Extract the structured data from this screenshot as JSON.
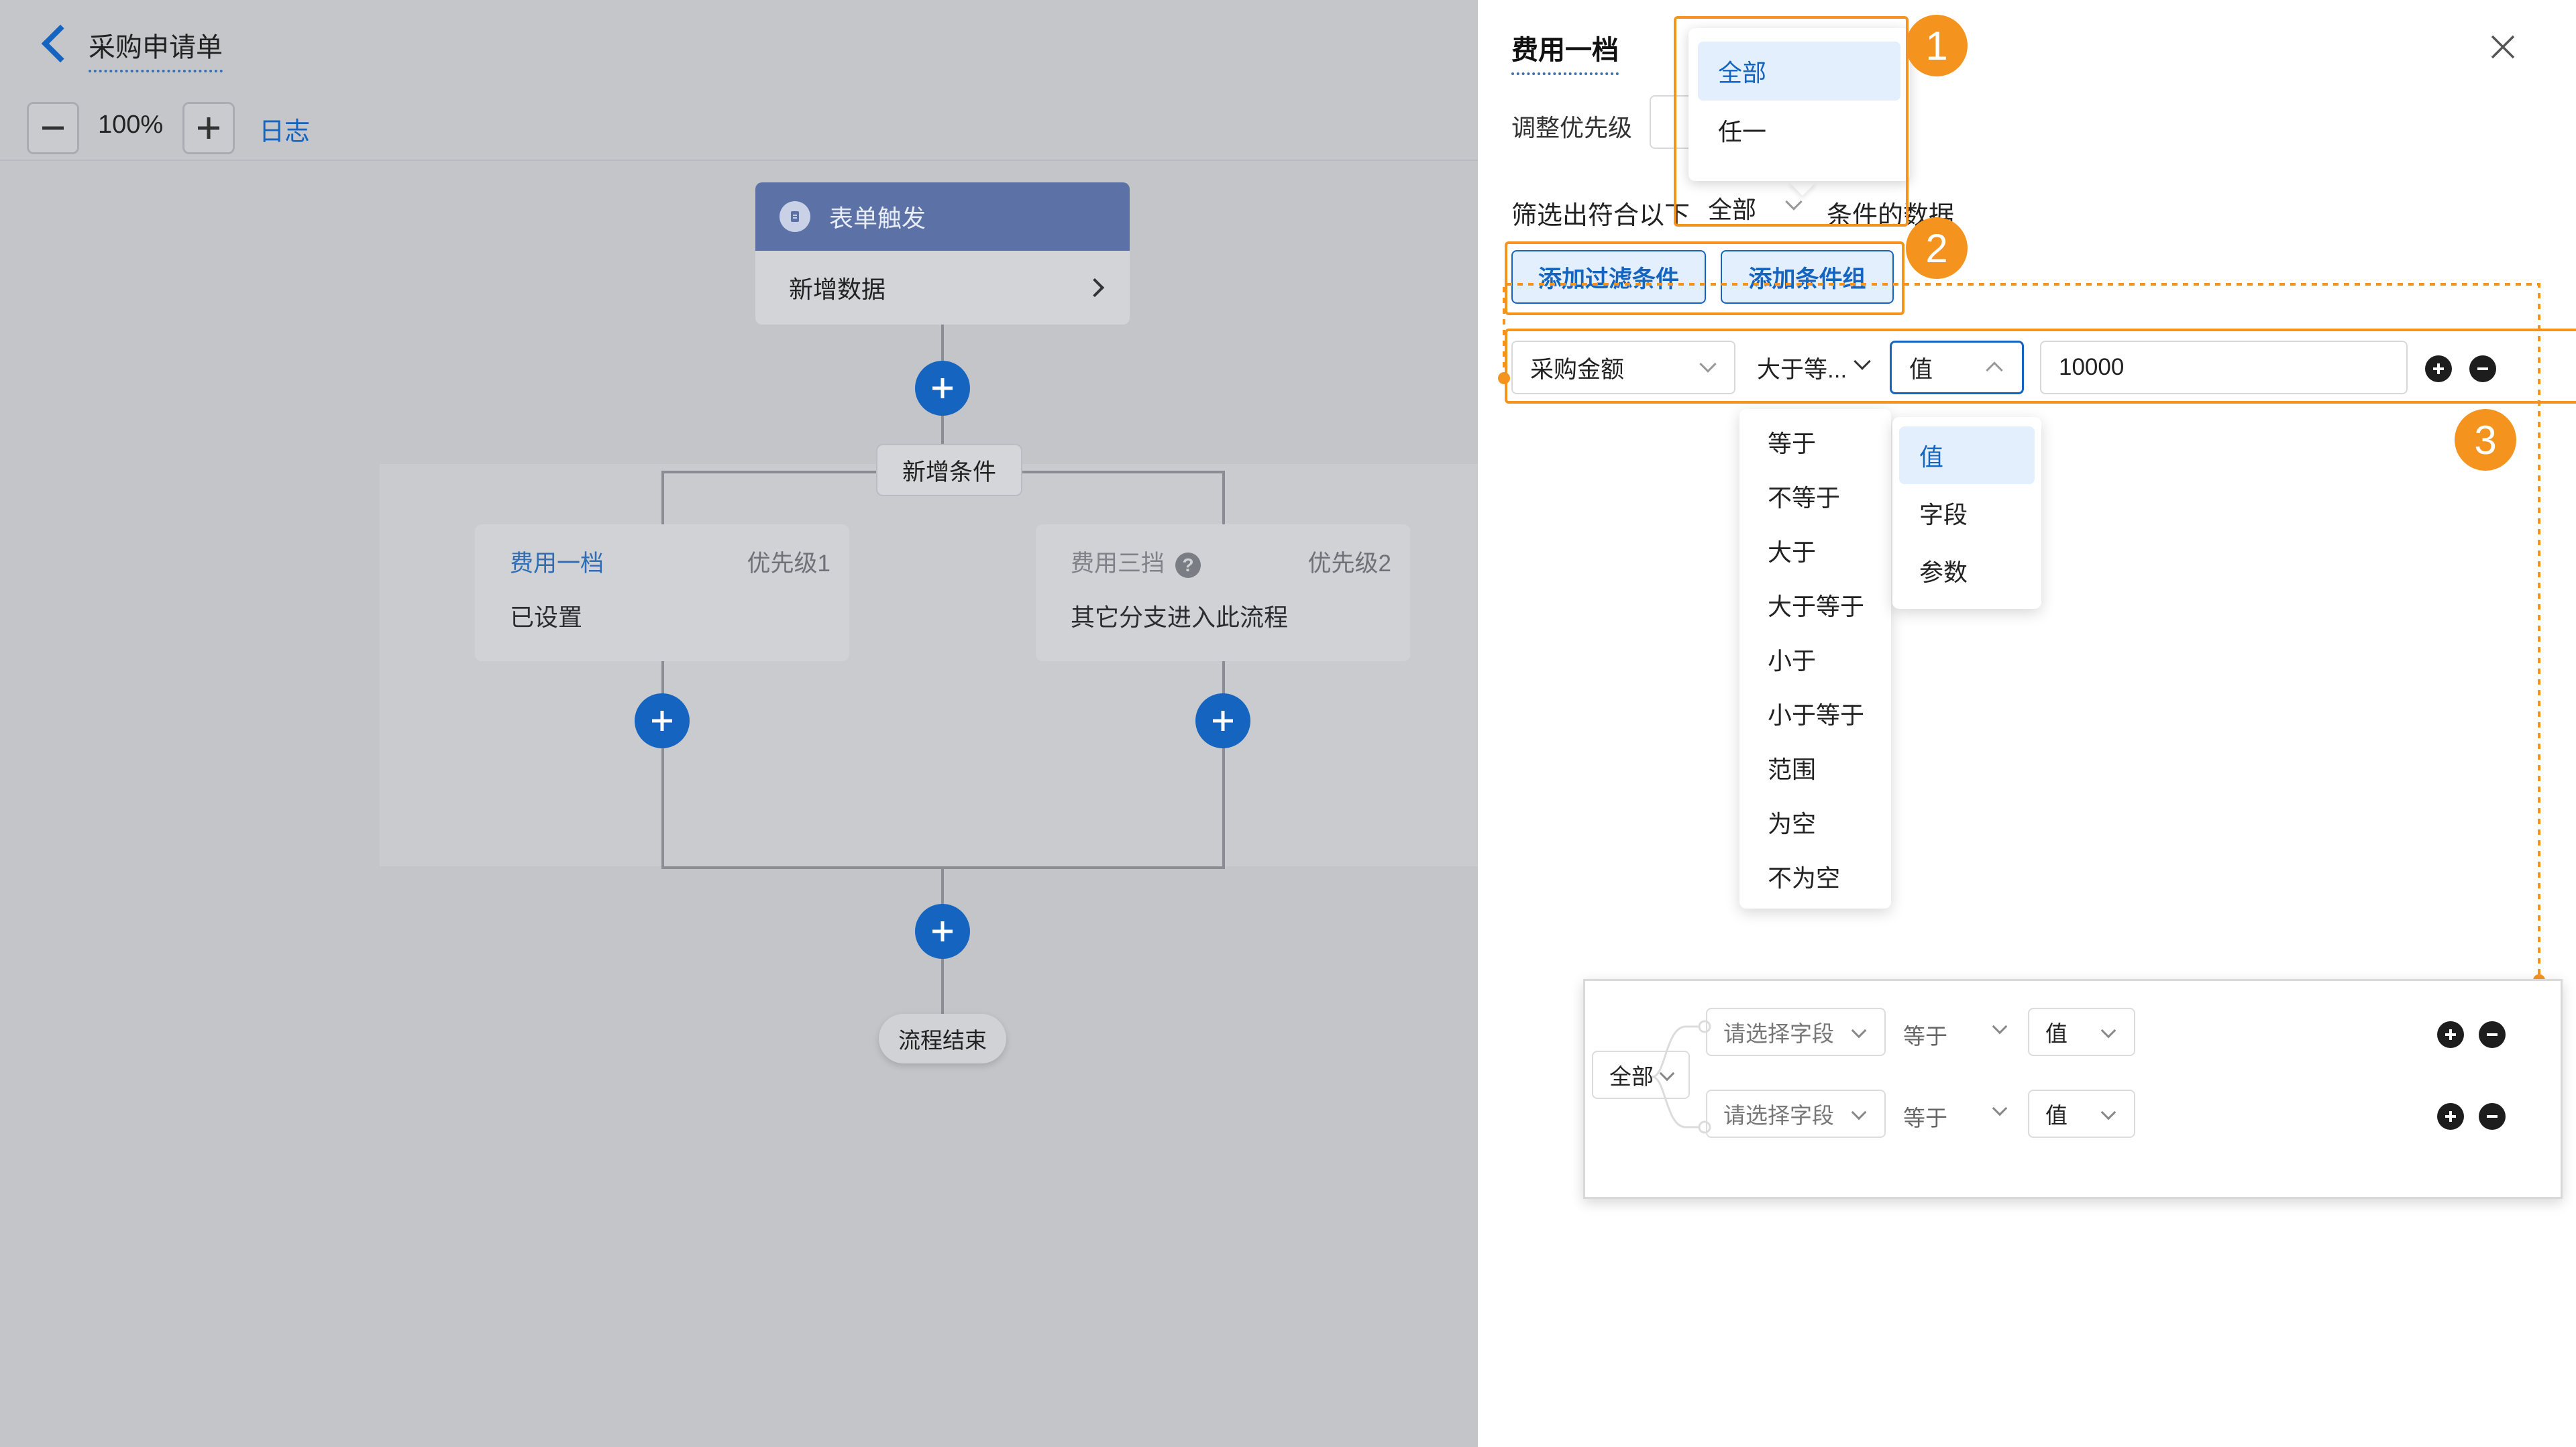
{
  "header": {
    "title": "采购申请单",
    "zoom": "100%",
    "log_label": "日志"
  },
  "flow": {
    "trigger": {
      "title": "表单触发",
      "body": "新增数据"
    },
    "add_condition_label": "新增条件",
    "branches": [
      {
        "title": "费用一档",
        "priority": "优先级1",
        "desc": "已设置"
      },
      {
        "title": "费用三挡",
        "priority": "优先级2",
        "desc": "其它分支进入此流程"
      }
    ],
    "end_label": "流程结束"
  },
  "panel": {
    "title": "费用一档",
    "priority_label": "调整优先级",
    "filter_prefix": "筛选出符合以下",
    "filter_match": "全部",
    "filter_suffix": "条件的数据",
    "add_filter_label": "添加过滤条件",
    "add_group_label": "添加条件组",
    "condition": {
      "field": "采购金额",
      "operator": "大于等...",
      "value_type": "值",
      "value": "10000"
    },
    "match_options": [
      "全部",
      "任一"
    ],
    "operator_options": [
      "等于",
      "不等于",
      "大于",
      "大于等于",
      "小于",
      "小于等于",
      "范围",
      "为空",
      "不为空"
    ],
    "value_type_options": [
      "值",
      "字段",
      "参数"
    ],
    "badges": [
      "1",
      "2",
      "3"
    ],
    "example_group": {
      "match": "全部",
      "rows": [
        {
          "field_placeholder": "请选择字段",
          "operator": "等于",
          "value_type": "值"
        },
        {
          "field_placeholder": "请选择字段",
          "operator": "等于",
          "value_type": "值"
        }
      ]
    }
  },
  "colors": {
    "primary": "#1565c0",
    "highlight": "#f5931f",
    "trigger_header": "#5c72a6"
  },
  "icons": [
    "back-icon",
    "minus-icon",
    "plus-icon",
    "form-icon",
    "chevron-right-icon",
    "help-icon",
    "close-icon",
    "chevron-down-icon",
    "chevron-up-icon",
    "add-circle-icon",
    "remove-circle-icon"
  ]
}
